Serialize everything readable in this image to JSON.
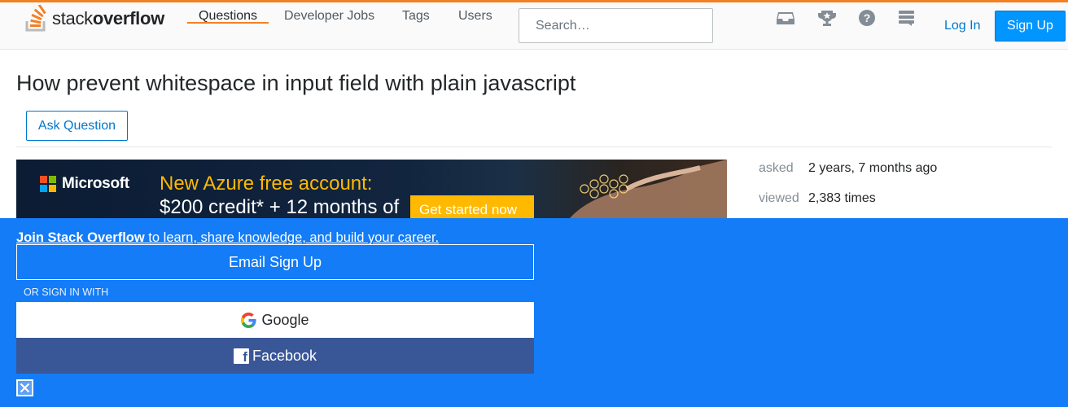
{
  "header": {
    "logo_text_light": "stack",
    "logo_text_bold": "overflow",
    "nav": [
      {
        "label": "Questions",
        "active": true
      },
      {
        "label": "Developer Jobs",
        "active": false
      },
      {
        "label": "Tags",
        "active": false
      },
      {
        "label": "Users",
        "active": false
      }
    ],
    "search_placeholder": "Search…",
    "icons": [
      "inbox-icon",
      "achievements-trophy-icon",
      "help-icon",
      "site-switcher-icon"
    ],
    "login_label": "Log In",
    "signup_label": "Sign Up"
  },
  "question": {
    "title": "How prevent whitespace in input field with plain javascript",
    "ask_button": "Ask Question",
    "asked_label": "asked",
    "asked_value": "2 years, 7 months ago",
    "viewed_label": "viewed",
    "viewed_value": "2,383 times"
  },
  "ad": {
    "brand": "Microsoft",
    "line1": "New Azure free account:",
    "line2": "$200 credit* + 12 months of",
    "cta": "Get started now"
  },
  "banner": {
    "join_link": "Join Stack Overflow",
    "join_rest": " to learn, share knowledge, and build your career.",
    "email_button": "Email Sign Up",
    "or_text": "OR SIGN IN WITH",
    "google_button": "Google",
    "facebook_button": "Facebook"
  },
  "colors": {
    "accent_orange": "#f48024",
    "link_blue": "#0077cc",
    "signup_blue": "#0095ff",
    "banner_blue": "#137cf6",
    "facebook_blue": "#395697"
  }
}
